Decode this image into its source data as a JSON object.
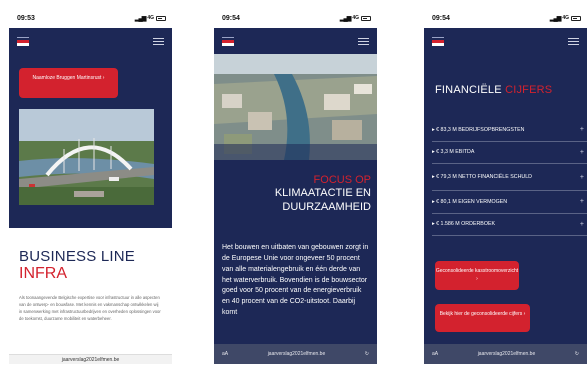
{
  "phone1": {
    "status": {
      "time": "09:53",
      "network": "4G"
    },
    "hero_button": "Naamloze Bruggen Martinsrust",
    "heading_line1": "BUSINESS LINE",
    "heading_line2": "INFRA",
    "body_text": "Als toonaangevende Belgische expertise voor infrastructuur in alle aspecten van de ontwerp- en bouwfase. Met kennis en vakmanschap ontwikkelen wij in samenwerking met infrastructuurbedrijven en overheden oplossingen voor de toekomst, duurzame mobiliteit en waterbeheer.",
    "url": "jaarverslag2021elfmen.be"
  },
  "phone2": {
    "status": {
      "time": "09:54",
      "network": "4G"
    },
    "focus_label": "FOCUS OP",
    "focus_title_line1": "KLIMAATACTIE EN",
    "focus_title_line2": "DUURZAAMHEID",
    "body_text": "Het bouwen en uitbaten van gebouwen zorgt in de Europese Unie voor ongeveer 50 procent van alle materialengebruik en één derde van het waterverbruik. Bovendien is de bouwsector goed voor 50 procent van de energieverbruik en 40 procent van de CO2-uitstoot. Daarbij komt",
    "url_prefix": "aA",
    "url": "jaarverslag2021elfmen.be"
  },
  "phone3": {
    "status": {
      "time": "09:54",
      "network": "4G"
    },
    "title_white": "FINANCIËLE",
    "title_red": "CIJFERS",
    "items": [
      "€ 83,3 M BEDRIJFSOPBRENGSTEN",
      "€ 3,3 M EBITDA",
      "€ 79,3 M NETTO FINANCIËLE SCHULD",
      "€ 80,1 M EIGEN VERMOGEN",
      "€ 1.586 M ORDERBOEK"
    ],
    "button1": "Geconsolideerde kasstroomoverzicht",
    "button2": "Bekijk hier de geconsolideerde cijfers",
    "url_prefix": "aA",
    "url": "jaarverslag2021elfmen.be"
  },
  "colors": {
    "navy": "#1d2856",
    "red": "#d3222e"
  }
}
